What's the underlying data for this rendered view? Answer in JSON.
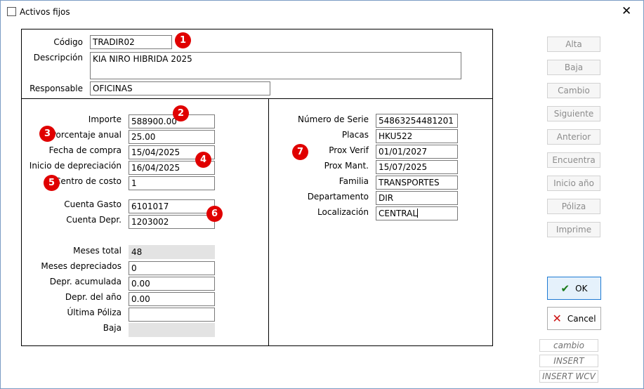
{
  "window": {
    "title": "Activos fijos",
    "close_glyph": "✕"
  },
  "header": {
    "codigo_label": "Código",
    "codigo_value": "TRADIR02",
    "descripcion_label": "Descripción",
    "descripcion_value": "KIA NIRO HIBRIDA 2025",
    "responsable_label": "Responsable",
    "responsable_value": "OFICINAS"
  },
  "left": {
    "importe_label": "Importe",
    "importe_value": "588900.00",
    "porcentaje_label": "Porcentaje anual",
    "porcentaje_value": "25.00",
    "fecha_compra_label": "Fecha de compra",
    "fecha_compra_value": "15/04/2025",
    "inicio_dep_label": "Inicio de depreciación",
    "inicio_dep_value": "16/04/2025",
    "centro_label": "Centro de costo",
    "centro_value": "1",
    "cuenta_gasto_label": "Cuenta Gasto",
    "cuenta_gasto_value": "6101017",
    "cuenta_depr_label": "Cuenta Depr.",
    "cuenta_depr_value": "1203002",
    "meses_total_label": "Meses total",
    "meses_total_value": "48",
    "meses_dep_label": "Meses depreciados",
    "meses_dep_value": "0",
    "depr_acum_label": "Depr. acumulada",
    "depr_acum_value": "0.00",
    "depr_anio_label": "Depr. del año",
    "depr_anio_value": "0.00",
    "ultima_poliza_label": "Última Póliza",
    "ultima_poliza_value": "",
    "baja_label": "Baja",
    "baja_value": ""
  },
  "right": {
    "serie_label": "Número de Serie",
    "serie_value": "54863254481201",
    "placas_label": "Placas",
    "placas_value": "HKU522",
    "prox_verif_label": "Prox Verif",
    "prox_verif_value": "01/01/2027",
    "prox_mant_label": "Prox Mant.",
    "prox_mant_value": "15/07/2025",
    "familia_label": "Familia",
    "familia_value": "TRANSPORTES",
    "departamento_label": "Departamento",
    "departamento_value": "DIR",
    "localizacion_label": "Localización",
    "localizacion_value": "CENTRAL"
  },
  "badges": [
    "1",
    "2",
    "3",
    "4",
    "5",
    "6",
    "7"
  ],
  "sidebar": [
    "Alta",
    "Baja",
    "Cambio",
    "Siguiente",
    "Anterior",
    "Encuentra",
    "Inicio año",
    "Póliza",
    "Imprime"
  ],
  "actions": {
    "ok_label": "OK",
    "ok_glyph": "✔",
    "cancel_label": "Cancel",
    "cancel_glyph": "✕"
  },
  "status": [
    "cambio",
    "INSERT",
    "INSERT WCV"
  ],
  "colors": {
    "badge": "#e00000",
    "ok_border": "#1e7ad3",
    "disabled_text": "#8c8c8c"
  }
}
